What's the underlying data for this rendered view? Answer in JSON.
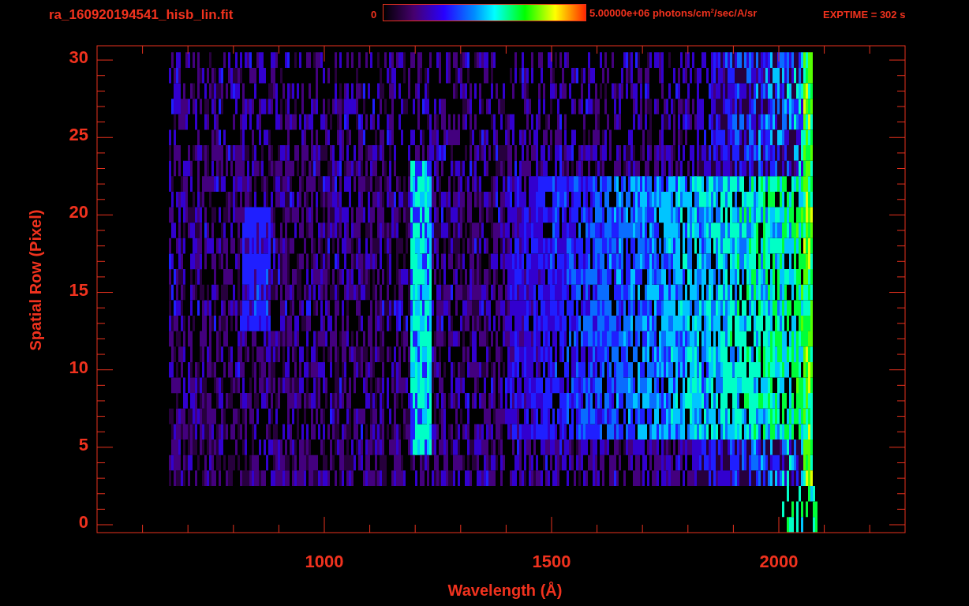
{
  "title": "ra_160920194541_hisb_lin.fit",
  "colorbar": {
    "min_label": "0",
    "max_label": "5.00000e+06 photons/cm$^{2}$/sec/A/sr",
    "exposure": "EXPTIME = 302 s"
  },
  "y_axis": {
    "label": "Spatial Row (Pixel)",
    "ticks": [
      "30",
      "25",
      "20",
      "15",
      "10",
      "5",
      "0"
    ]
  },
  "x_axis": {
    "label": "Wavelength (Å)",
    "ticks": [
      "1000",
      "1500",
      "2000"
    ]
  }
}
